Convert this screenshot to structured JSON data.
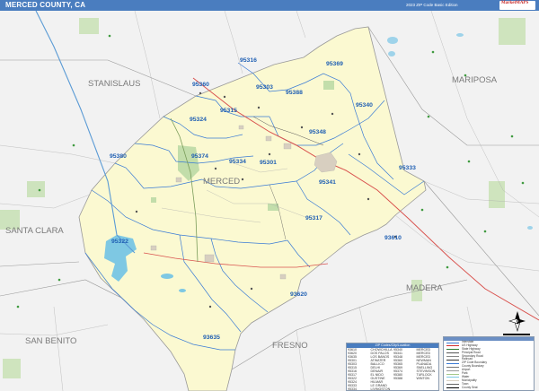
{
  "header": {
    "title": "MERCED COUNTY, CA",
    "subtitle": "2023 ZIP Code Basic Edition",
    "logo_line1": "MarketMAPS",
    "logo_line2": "MAPS"
  },
  "counties": {
    "merced": "MERCED",
    "stanislaus": "STANISLAUS",
    "mariposa": "MARIPOSA",
    "santa_clara": "SANTA CLARA",
    "madera": "MADERA",
    "san_benito": "SAN BENITO",
    "fresno": "FRESNO"
  },
  "zip_codes": [
    {
      "code": "95316"
    },
    {
      "code": "95369"
    },
    {
      "code": "95360"
    },
    {
      "code": "95303"
    },
    {
      "code": "95388"
    },
    {
      "code": "95315"
    },
    {
      "code": "95340"
    },
    {
      "code": "95324"
    },
    {
      "code": "95348"
    },
    {
      "code": "95380"
    },
    {
      "code": "95374"
    },
    {
      "code": "95334"
    },
    {
      "code": "95301"
    },
    {
      "code": "95333"
    },
    {
      "code": "95341"
    },
    {
      "code": "95317"
    },
    {
      "code": "95322"
    },
    {
      "code": "93610"
    },
    {
      "code": "93620"
    },
    {
      "code": "93635"
    }
  ],
  "zip_table": {
    "header": "ZIP Codes/City/Location",
    "rows": [
      [
        "93610",
        "CHOWCHILLA",
        "95340",
        "MERCED"
      ],
      [
        "93620",
        "DOS PALOS",
        "95341",
        "MERCED"
      ],
      [
        "93635",
        "LOS BANOS",
        "95348",
        "MERCED"
      ],
      [
        "95301",
        "ATWATER",
        "95360",
        "NEWMAN"
      ],
      [
        "95303",
        "BALLICO",
        "95365",
        "PLANADA"
      ],
      [
        "95315",
        "DELHI",
        "95369",
        "SNELLING"
      ],
      [
        "95316",
        "DENAIR",
        "95374",
        "STEVINSON"
      ],
      [
        "95317",
        "EL NIDO",
        "95380",
        "TURLOCK"
      ],
      [
        "95322",
        "GUSTINE",
        "95388",
        "WINTON"
      ],
      [
        "95324",
        "HILMAR",
        "",
        ""
      ],
      [
        "95333",
        "LE GRAND",
        "",
        ""
      ],
      [
        "95334",
        "LIVINGSTON",
        "",
        ""
      ]
    ]
  },
  "legend": {
    "items": [
      {
        "label": "Interstate",
        "color": "#3a7bd5"
      },
      {
        "label": "US Highway",
        "color": "#d32f2f"
      },
      {
        "label": "State Highway",
        "color": "#2e7d32"
      },
      {
        "label": "Principal Road",
        "color": "#555555"
      },
      {
        "label": "Secondary Road",
        "color": "#888888"
      },
      {
        "label": "Railroad",
        "color": "#333333"
      },
      {
        "label": "ZIP Code Boundary",
        "color": "#3a7bd5"
      },
      {
        "label": "County Boundary",
        "color": "#777777"
      },
      {
        "label": "Airport",
        "color": "#999999"
      },
      {
        "label": "Park",
        "color": "#a5c98a"
      },
      {
        "label": "Water",
        "color": "#7ec8e3"
      },
      {
        "label": "Municipality",
        "color": "#d8cfc0"
      },
      {
        "label": "Town",
        "color": "#666666"
      },
      {
        "label": "County Seat",
        "color": "#000000"
      }
    ]
  },
  "colors": {
    "county_fill": "#fbf9d1",
    "surrounding": "#f2f2f2",
    "zip_boundary": "#3a7bd5",
    "zip_label": "#1f5fb3",
    "county_label": "#7a7a7a",
    "water": "#7ec8e3",
    "park": "#b9d9a4"
  },
  "compass": {
    "n": "N"
  }
}
